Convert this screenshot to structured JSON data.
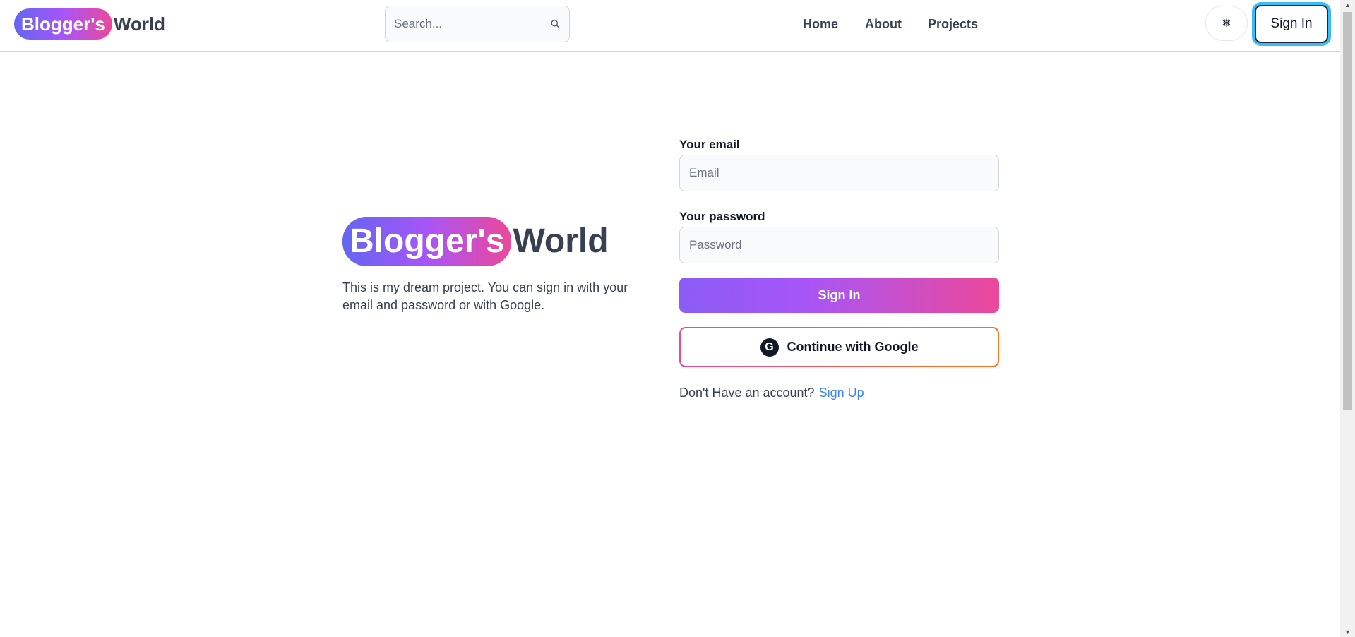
{
  "header": {
    "brand_pill": "Blogger's",
    "brand_word": "World",
    "search_placeholder": "Search...",
    "search_icon": "search-icon",
    "nav": [
      {
        "label": "Home"
      },
      {
        "label": "About"
      },
      {
        "label": "Projects"
      }
    ],
    "theme_icon": "❅",
    "signin_label": "Sign In"
  },
  "intro": {
    "brand_pill": "Blogger's",
    "brand_word": "World",
    "text": "This is my dream project. You can sign in with your email and password or with Google."
  },
  "form": {
    "email_label": "Your email",
    "email_placeholder": "Email",
    "password_label": "Your password",
    "password_placeholder": "Password",
    "submit_label": "Sign In",
    "google_label": "Continue with Google",
    "google_icon_glyph": "G",
    "account_text": "Don't Have an account?",
    "signup_label": "Sign Up"
  },
  "colors": {
    "accent_gradient_start": "#6366f1",
    "accent_gradient_end": "#ec4899",
    "link": "#3b82f6",
    "focus_ring": "#38bdf8"
  }
}
